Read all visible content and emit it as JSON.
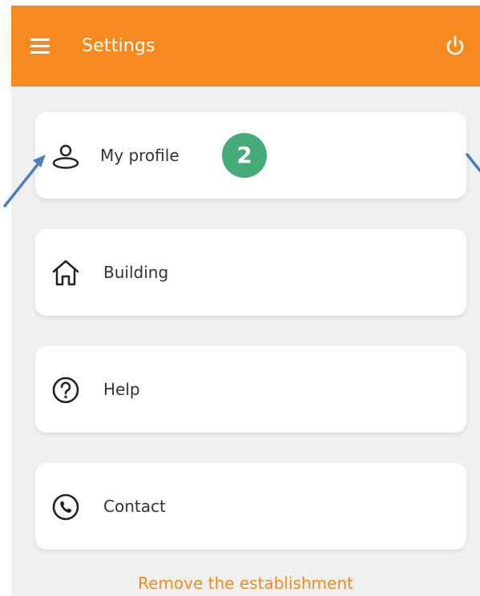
{
  "header": {
    "title": "Settings",
    "menu_icon": "hamburger-menu-icon",
    "power_icon": "power-icon"
  },
  "menu": {
    "items": [
      {
        "label": "My profile",
        "icon": "user-icon",
        "badge": "2"
      },
      {
        "label": "Building",
        "icon": "home-icon"
      },
      {
        "label": "Help",
        "icon": "help-circle-icon"
      },
      {
        "label": "Contact",
        "icon": "phone-icon"
      }
    ]
  },
  "footer": {
    "remove_label": "Remove the establishment"
  },
  "colors": {
    "brand": "#f6891f",
    "badge": "#47ab79",
    "background": "#f0f0f0",
    "annotation_arrow": "#4a7ec0"
  }
}
